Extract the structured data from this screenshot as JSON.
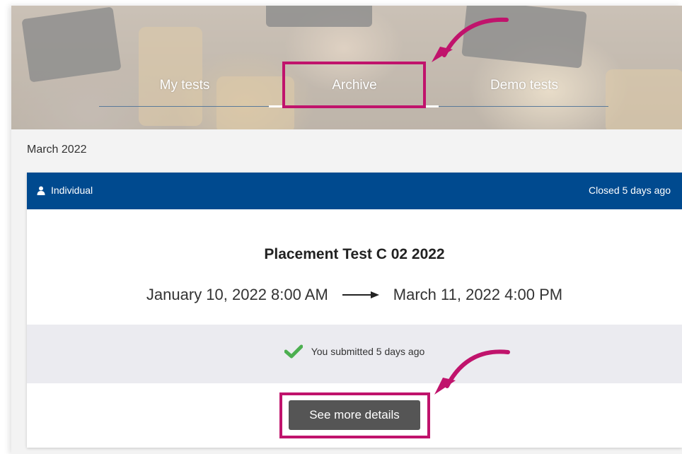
{
  "tabs": [
    {
      "label": "My tests"
    },
    {
      "label": "Archive",
      "active": true
    },
    {
      "label": "Demo tests"
    }
  ],
  "month_heading": "March 2022",
  "card": {
    "type_label": "Individual",
    "status": "Closed 5 days ago",
    "title": "Placement Test C 02 2022",
    "start": "January 10, 2022 8:00 AM",
    "end": "March 11, 2022 4:00 PM",
    "submission_status": "You submitted 5 days ago",
    "details_button": "See more details"
  },
  "colors": {
    "header_blue": "#004a8f",
    "highlight_magenta": "#c0136c",
    "check_green": "#4caf50",
    "button_gray": "#555555"
  },
  "icons": [
    "user-icon",
    "right-arrow-icon",
    "checkmark-icon",
    "curved-arrow-icon"
  ]
}
